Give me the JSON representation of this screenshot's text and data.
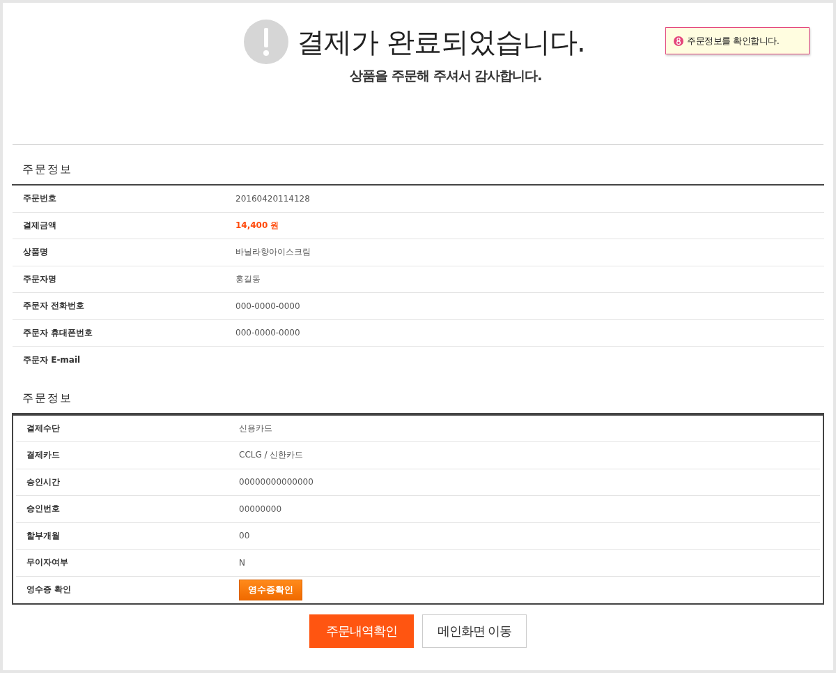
{
  "header": {
    "title": "결제가 완료되었습니다.",
    "subtitle": "상품을 주문해 주셔서 감사합니다."
  },
  "notice": {
    "text": "주문정보를 확인합니다."
  },
  "sections": [
    {
      "title": "주문정보",
      "boxed": false,
      "rows": [
        {
          "label": "주문번호",
          "value": "20160420114128",
          "kind": "text"
        },
        {
          "label": "결제금액",
          "value": "14,400 원",
          "kind": "price"
        },
        {
          "label": "상품명",
          "value": "바닐라향아이스크림",
          "kind": "text"
        },
        {
          "label": "주문자명",
          "value": "홍길동",
          "kind": "text"
        },
        {
          "label": "주문자 전화번호",
          "value": "000-0000-0000",
          "kind": "text"
        },
        {
          "label": "주문자 휴대폰번호",
          "value": "000-0000-0000",
          "kind": "text"
        },
        {
          "label": "주문자 E-mail",
          "kind": "text"
        }
      ]
    },
    {
      "title": "주문정보",
      "boxed": true,
      "rows": [
        {
          "label": "결제수단",
          "value": "신용카드",
          "kind": "text"
        },
        {
          "label": "결제카드",
          "value": "CCLG / 신한카드",
          "kind": "text"
        },
        {
          "label": "승인시간",
          "value": "00000000000000",
          "kind": "text"
        },
        {
          "label": "승인번호",
          "value": "00000000",
          "kind": "text"
        },
        {
          "label": "할부개월",
          "value": "00",
          "kind": "text"
        },
        {
          "label": "무이자여부",
          "value": "N",
          "kind": "text"
        },
        {
          "label": "영수증 확인",
          "value": "영수증확인",
          "kind": "button"
        }
      ]
    }
  ],
  "buttons": [
    {
      "label": "주문내역확인",
      "kind": "primary"
    },
    {
      "label": "메인화면 이동",
      "kind": "secondary"
    }
  ]
}
